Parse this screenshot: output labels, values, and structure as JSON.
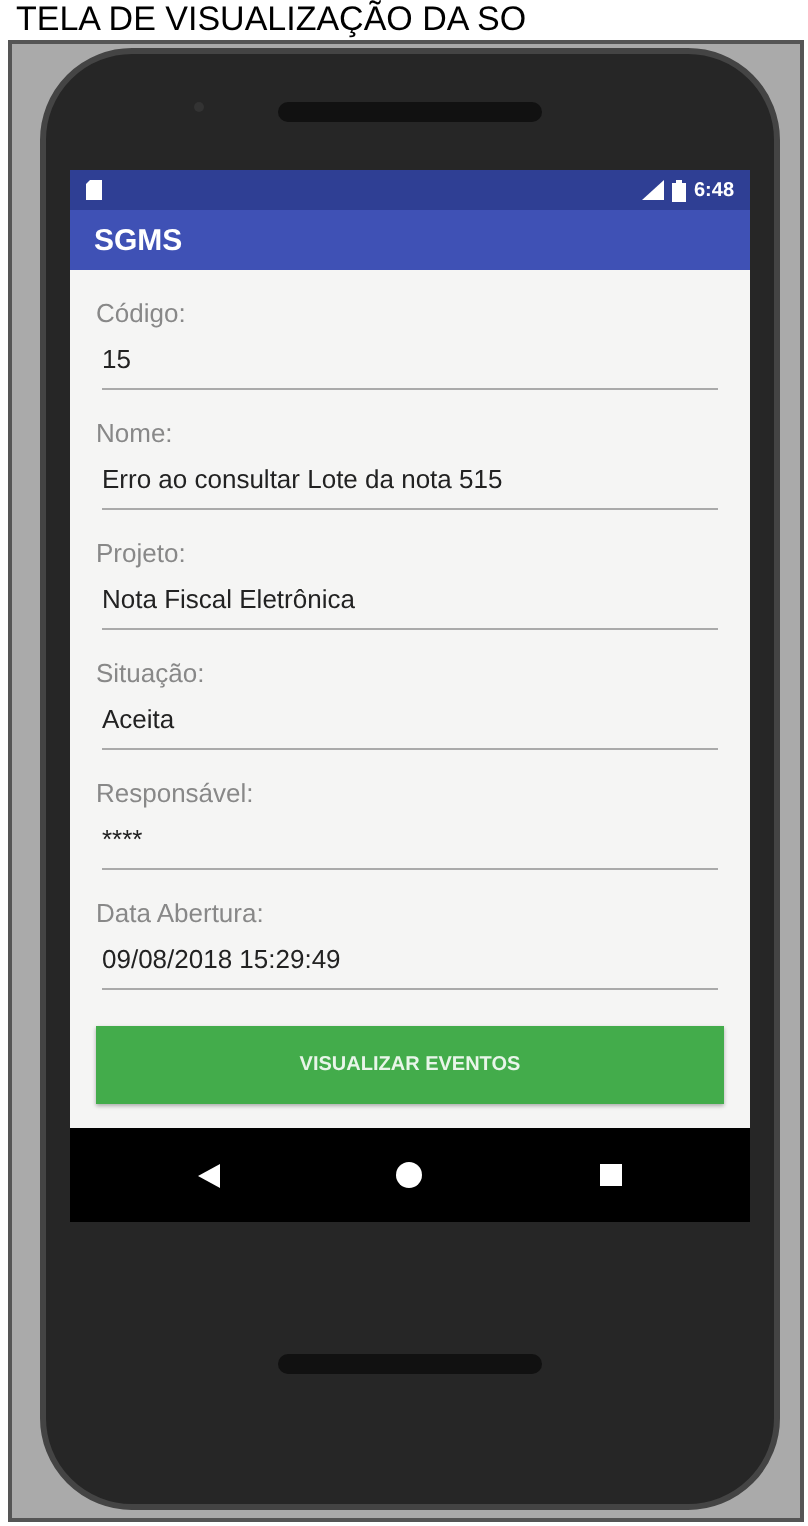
{
  "caption": "TELA DE VISUALIZAÇÃO DA SO",
  "status_bar": {
    "time": "6:48"
  },
  "app_bar": {
    "title": "SGMS"
  },
  "fields": [
    {
      "label": "Código:",
      "value": "15"
    },
    {
      "label": "Nome:",
      "value": "Erro ao consultar Lote da nota 515"
    },
    {
      "label": "Projeto:",
      "value": "Nota Fiscal Eletrônica"
    },
    {
      "label": "Situação:",
      "value": "Aceita"
    },
    {
      "label": "Responsável:",
      "value": "****"
    },
    {
      "label": "Data Abertura:",
      "value": "09/08/2018 15:29:49"
    }
  ],
  "button": {
    "label": "VISUALIZAR EVENTOS"
  }
}
